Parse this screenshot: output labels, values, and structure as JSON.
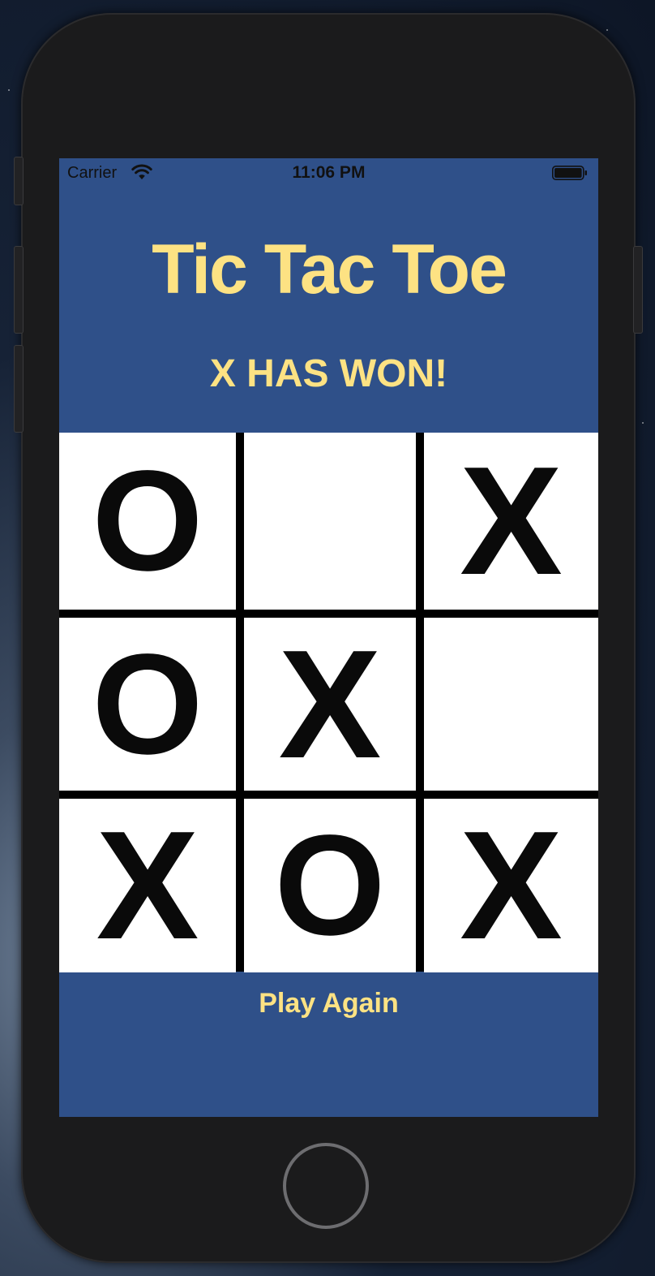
{
  "status_bar": {
    "carrier": "Carrier",
    "time": "11:06 PM",
    "wifi_icon": "wifi-icon",
    "battery_icon": "battery-full-icon"
  },
  "header": {
    "title": "Tic Tac Toe",
    "status_message": "X HAS WON!"
  },
  "board": {
    "cells": [
      [
        "O",
        "",
        "X"
      ],
      [
        "O",
        "X",
        ""
      ],
      [
        "X",
        "O",
        "X"
      ]
    ]
  },
  "footer": {
    "play_again_label": "Play Again"
  },
  "colors": {
    "background": "#2f5089",
    "accent_text": "#fde283",
    "cell_background": "#ffffff",
    "grid_lines": "#000000"
  }
}
